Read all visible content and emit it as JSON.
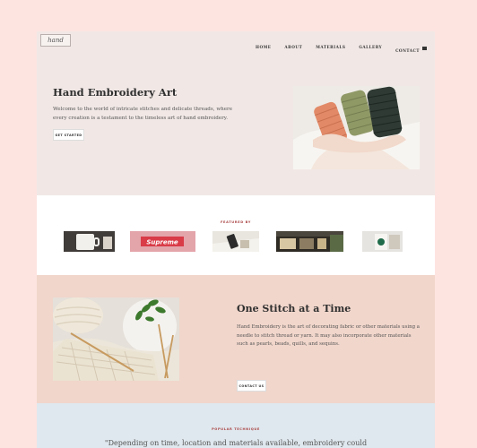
{
  "header": {
    "logo_text": "hand",
    "nav": [
      "HOME",
      "ABOUT",
      "MATERIALS",
      "GALLERY",
      "CONTACT"
    ]
  },
  "hero": {
    "title": "Hand Embroidery Art",
    "text": "Welcome to the world of intricate stitches and delicate threads, where every creation is a testament to the timeless art of hand embroidery.",
    "button": "GET STARTED"
  },
  "featured": {
    "label": "FEATURED BY",
    "logos": [
      "mug-logo",
      "supreme-logo",
      "phone-logo",
      "storefront-logo",
      "starbucks-logo"
    ],
    "supreme_text": "Supreme"
  },
  "stitch": {
    "title": "One Stitch at a Time",
    "text": "Hand Embroidery is the art of decorating fabric or other materials using a needle to stitch thread or yarn. It may also incorporate other materials such as pearls, beads, quills, and sequins.",
    "button": "CONTACT US"
  },
  "popular": {
    "label": "POPULAR TECHNIQUE",
    "quote": "\"Depending on time, location and materials available, embroidery could"
  }
}
